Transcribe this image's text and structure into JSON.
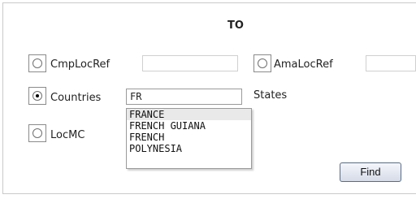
{
  "form": {
    "title": "TO",
    "radios": [
      {
        "label": "CmpLocRef",
        "checked": false
      },
      {
        "label": "AmaLocRef",
        "checked": false
      },
      {
        "label": "Countries",
        "checked": true
      },
      {
        "label": "LocMC",
        "checked": false
      }
    ],
    "countries_value": "FR",
    "states_label": "States",
    "suggestions": [
      "FRANCE",
      "FRENCH GUIANA",
      "FRENCH",
      "POLYNESIA"
    ],
    "find_label": "Find"
  }
}
